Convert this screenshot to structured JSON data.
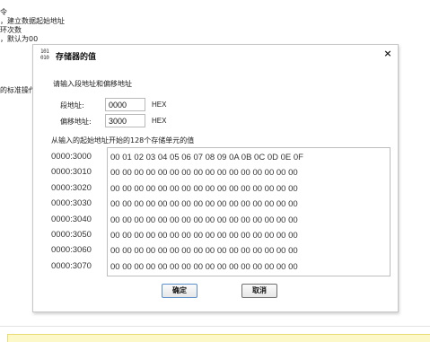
{
  "background": {
    "lines": [
      "令",
      "，建立数据起始地址",
      "环次数",
      "，默认为00",
      "的标准操作"
    ]
  },
  "dialog": {
    "icon_glyph": [
      "101",
      "010"
    ],
    "title": "存储器的值",
    "close_symbol": "×",
    "prompt": "请输入段地址和偏移地址",
    "segment": {
      "label": "段地址:",
      "value": "0000",
      "unit": "HEX"
    },
    "offset": {
      "label": "偏移地址:",
      "value": "3000",
      "unit": "HEX"
    },
    "caption": "从输入的起始地址开始的128个存储单元的值",
    "memory": {
      "addresses": [
        "0000:3000",
        "0000:3010",
        "0000:3020",
        "0000:3030",
        "0000:3040",
        "0000:3050",
        "0000:3060",
        "0000:3070"
      ],
      "rows": [
        "00  01  02  03  04  05  06  07  08  09  0A  0B  0C  0D  0E  0F",
        "00  00  00  00  00  00  00  00  00  00  00  00  00  00  00  00",
        "00  00  00  00  00  00  00  00  00  00  00  00  00  00  00  00",
        "00  00  00  00  00  00  00  00  00  00  00  00  00  00  00  00",
        "00  00  00  00  00  00  00  00  00  00  00  00  00  00  00  00",
        "00  00  00  00  00  00  00  00  00  00  00  00  00  00  00  00",
        "00  00  00  00  00  00  00  00  00  00  00  00  00  00  00  00",
        "00  00  00  00  00  00  00  00  00  00  00  00  00  00  00  00"
      ]
    },
    "ok_label": "确定",
    "cancel_label": "取消"
  }
}
